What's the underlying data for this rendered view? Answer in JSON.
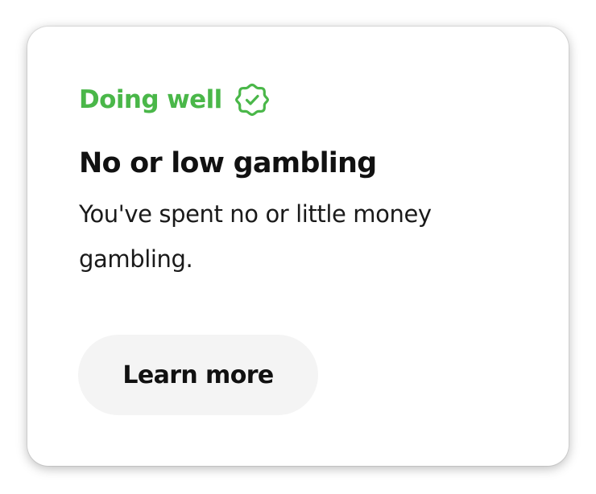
{
  "card": {
    "status_label": "Doing well",
    "status_icon": "verified-badge-check-icon",
    "headline": "No or low gambling",
    "description": "You've spent no or little money gambling.",
    "button_label": "Learn more"
  },
  "colors": {
    "status_green": "#4ab749",
    "text": "#111111",
    "button_bg": "#f4f4f4",
    "card_bg": "#ffffff"
  }
}
